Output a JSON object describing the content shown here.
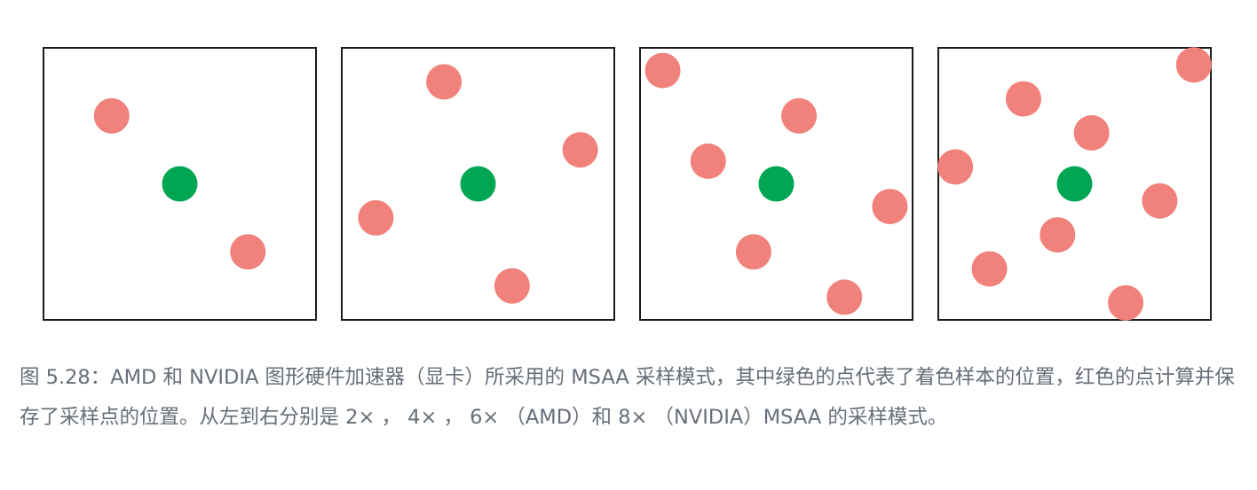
{
  "figure": {
    "colors": {
      "frame": "#1a1a1a",
      "shading_sample": "#00a651",
      "sample_point": "#f0817b"
    },
    "panels": [
      {
        "name": "2x",
        "samples": [
          [
            0.25,
            0.25
          ],
          [
            0.75,
            0.75
          ]
        ]
      },
      {
        "name": "4x",
        "samples": [
          [
            0.375,
            0.125
          ],
          [
            0.875,
            0.375
          ],
          [
            0.125,
            0.625
          ],
          [
            0.625,
            0.875
          ]
        ]
      },
      {
        "name": "6x",
        "samples": [
          [
            0.0833,
            0.0833
          ],
          [
            0.5833,
            0.25
          ],
          [
            0.25,
            0.4167
          ],
          [
            0.9167,
            0.5833
          ],
          [
            0.4167,
            0.75
          ],
          [
            0.75,
            0.9167
          ]
        ]
      },
      {
        "name": "8x",
        "samples": [
          [
            0.9375,
            0.0625
          ],
          [
            0.3125,
            0.1875
          ],
          [
            0.5625,
            0.3125
          ],
          [
            0.0625,
            0.4375
          ],
          [
            0.8125,
            0.5625
          ],
          [
            0.4375,
            0.6875
          ],
          [
            0.1875,
            0.8125
          ],
          [
            0.6875,
            0.9375
          ]
        ]
      }
    ]
  },
  "caption": {
    "text": "图 5.28：AMD 和 NVIDIA 图形硬件加速器（显卡）所采用的 MSAA 采样模式，其中绿色的点代表了着色样本的位置，红色的点计算并保存了采样点的位置。从左到右分别是 2× ， 4× ， 6× （AMD）和 8× （NVIDIA）MSAA 的采样模式。"
  }
}
